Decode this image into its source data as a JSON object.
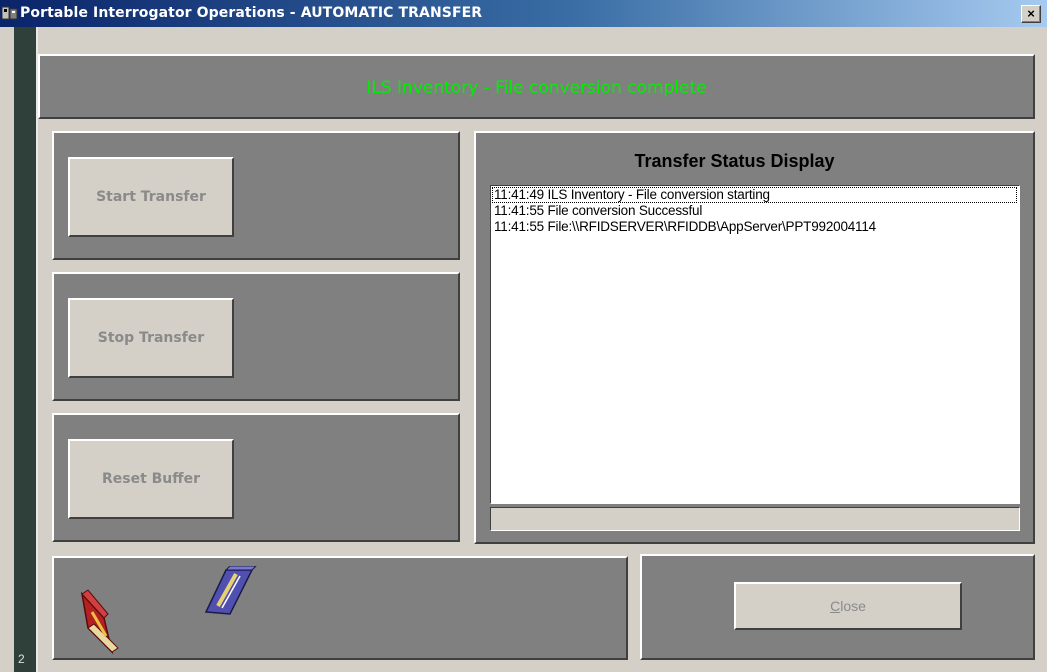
{
  "window": {
    "title": "Portable Interrogator Operations  -  AUTOMATIC TRANSFER",
    "close_glyph": "×"
  },
  "sidebar": {
    "number": "2"
  },
  "header": {
    "status_text": "ILS Inventory - File conversion complete",
    "status_color": "#00ee00"
  },
  "buttons": {
    "start": "Start Transfer",
    "stop": "Stop Transfer",
    "reset": "Reset Buffer",
    "close_first": "C",
    "close_rest": "lose"
  },
  "transfer_status": {
    "heading": "Transfer Status Display",
    "lines": [
      "11:41:49 ILS Inventory - File conversion starting",
      "11:41:55 File conversion Successful",
      "11:41:55 File:\\\\RFIDSERVER\\RFIDDB\\AppServer\\PPT992004114"
    ]
  },
  "icons": {
    "app": "app-icon",
    "book_red": "red-book-icon",
    "book_blue": "blue-book-icon"
  },
  "colors": {
    "panel": "#808080",
    "face": "#d4d0c8",
    "title_start": "#0a246a",
    "title_end": "#a6caf0"
  }
}
